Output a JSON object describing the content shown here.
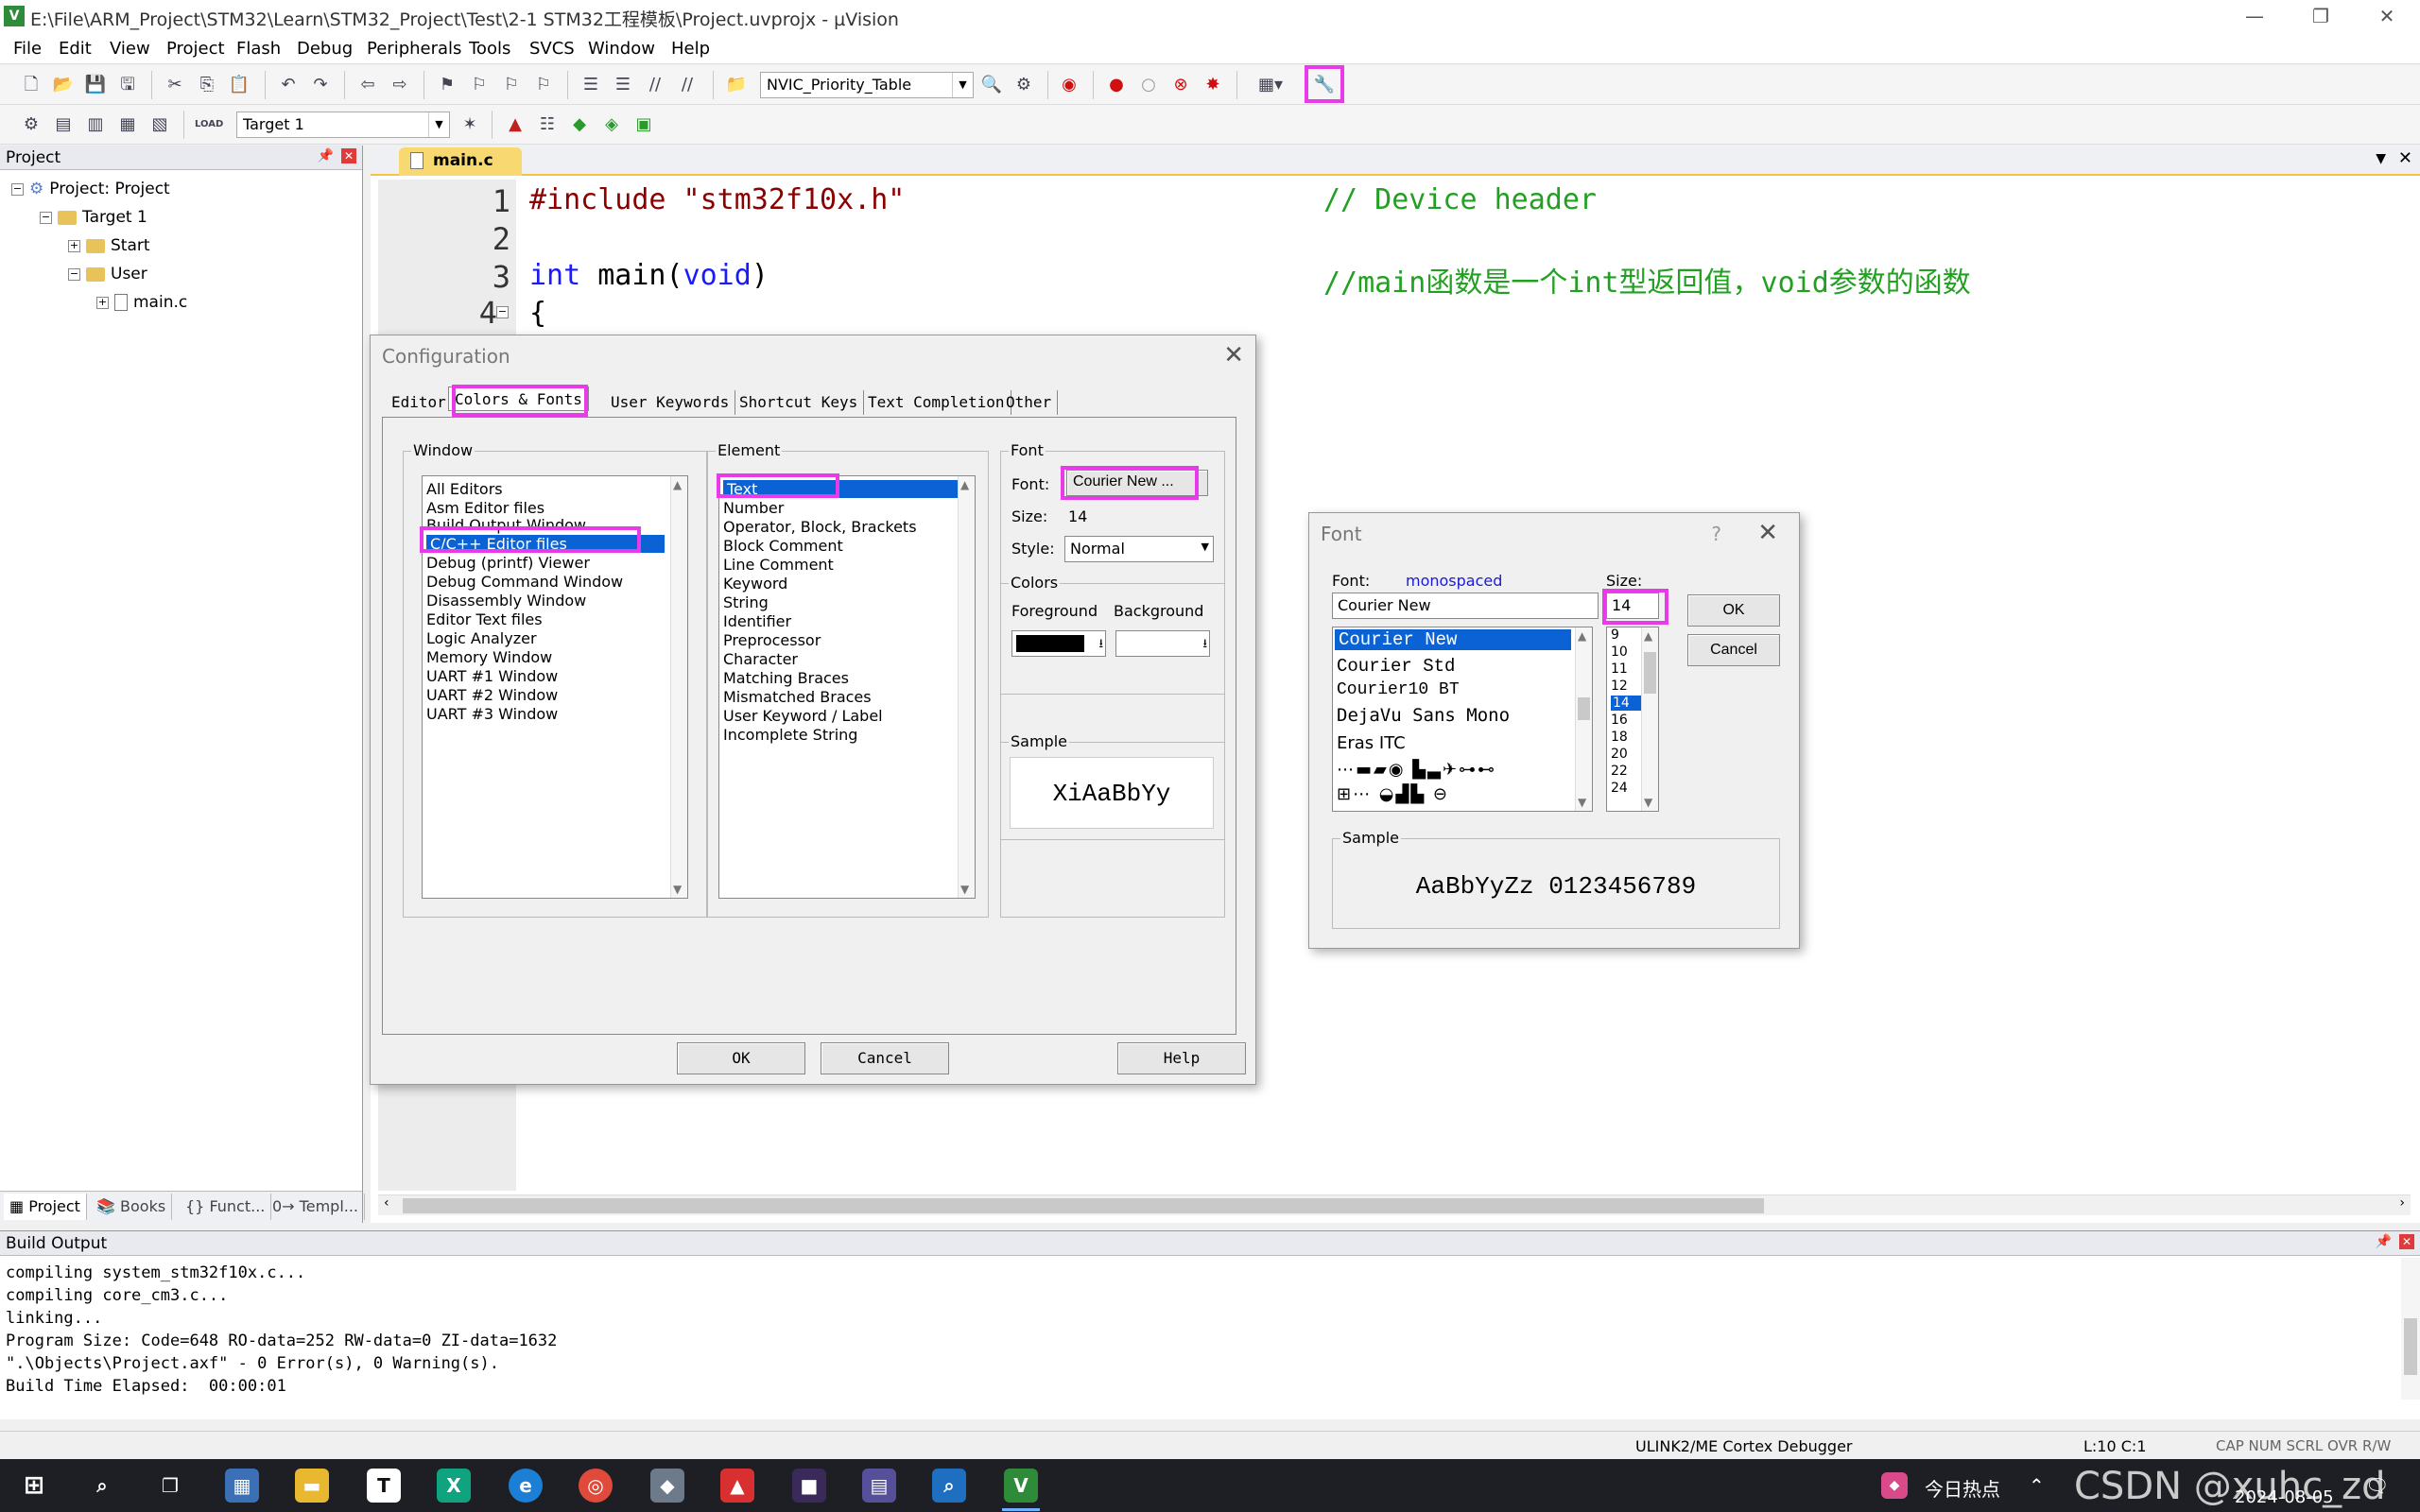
{
  "window": {
    "title": "E:\\File\\ARM_Project\\STM32\\Learn\\STM32_Project\\Test\\2-1 STM32工程模板\\Project.uvprojx - µVision",
    "icon_text": "V"
  },
  "menu": [
    "File",
    "Edit",
    "View",
    "Project",
    "Flash",
    "Debug",
    "Peripherals",
    "Tools",
    "SVCS",
    "Window",
    "Help"
  ],
  "toolbar": {
    "function_combo": "NVIC_Priority_Table",
    "target_combo": "Target 1",
    "load_label": "LOAD"
  },
  "project_panel": {
    "header": "Project",
    "tree": {
      "root": "Project: Project",
      "target": "Target 1",
      "group1": "Start",
      "group2": "User",
      "file": "main.c"
    },
    "tabs": [
      "Project",
      "Books",
      "{} Funct...",
      "0→ Templ..."
    ]
  },
  "editor": {
    "tab": "main.c",
    "lines": [
      {
        "num": "1",
        "code": "#include \"stm32f10x.h\"",
        "comment": "// Device header"
      },
      {
        "num": "2",
        "code": "",
        "comment": ""
      },
      {
        "num": "3",
        "kw1": "int",
        "code": " main(",
        "kw2": "void",
        "code2": ")",
        "comment": "//main函数是一个int型返回值，void参数的函数"
      },
      {
        "num": "4",
        "code": "{",
        "comment": ""
      }
    ]
  },
  "config_dialog": {
    "title": "Configuration",
    "tabs": [
      "Editor",
      "Colors & Fonts",
      "User Keywords",
      "Shortcut Keys",
      "Text Completion",
      "Other"
    ],
    "window_label": "Window",
    "window_items": [
      "All Editors",
      "Asm Editor files",
      "Build Output Window",
      "C/C++ Editor files",
      "Debug (printf) Viewer",
      "Debug Command Window",
      "Disassembly Window",
      "Editor Text files",
      "Logic Analyzer",
      "Memory Window",
      "UART #1 Window",
      "UART #2 Window",
      "UART #3 Window"
    ],
    "element_label": "Element",
    "element_items": [
      "Text",
      "Number",
      "Operator, Block, Brackets",
      "Block Comment",
      "Line Comment",
      "Keyword",
      "String",
      "Identifier",
      "Preprocessor",
      "Character",
      "Matching Braces",
      "Mismatched Braces",
      "User Keyword / Label",
      "Incomplete String"
    ],
    "font_group": "Font",
    "font_label": "Font:",
    "font_button": "Courier New ...",
    "size_label": "Size:",
    "size_value": "14",
    "style_label": "Style:",
    "style_value": "Normal",
    "colors_group": "Colors",
    "foreground_label": "Foreground",
    "background_label": "Background",
    "sample_group": "Sample",
    "sample_text": "XiAaBbYy",
    "ok": "OK",
    "cancel": "Cancel",
    "help": "Help"
  },
  "font_dialog": {
    "title": "Font",
    "help_q": "?",
    "font_label": "Font:",
    "monospaced_label": "monospaced",
    "size_label": "Size:",
    "font_value": "Courier New",
    "size_value": "14",
    "fonts": [
      "Courier New",
      "Courier Std",
      "Courier10 BT",
      "DejaVu Sans Mono",
      "Eras ITC"
    ],
    "sizes": [
      "9",
      "10",
      "11",
      "12",
      "14",
      "16",
      "18",
      "20",
      "22",
      "24"
    ],
    "ok": "OK",
    "cancel": "Cancel",
    "sample_group": "Sample",
    "sample_text": "AaBbYyZz 0123456789"
  },
  "build_output": {
    "header": "Build Output",
    "lines": [
      "compiling system_stm32f10x.c...",
      "compiling core_cm3.c...",
      "linking...",
      "Program Size: Code=648 RO-data=252 RW-data=0 ZI-data=1632",
      "\".\\Objects\\Project.axf\" - 0 Error(s), 0 Warning(s).",
      "Build Time Elapsed:  00:00:01"
    ]
  },
  "status_bar": {
    "debugger": "ULINK2/ME Cortex Debugger",
    "position": "L:10 C:1",
    "indicators": "CAP  NUM  SCRL  OVR  R/W"
  },
  "taskbar": {
    "news": "今日热点",
    "date": "2024-08-05",
    "watermark": "CSDN @xuhc_zd"
  },
  "colors": {
    "highlight": "#e83ae8",
    "selection": "#0a62d4",
    "keyword": "#1a1aff",
    "comment": "#22a022",
    "string": "#8b0000"
  }
}
